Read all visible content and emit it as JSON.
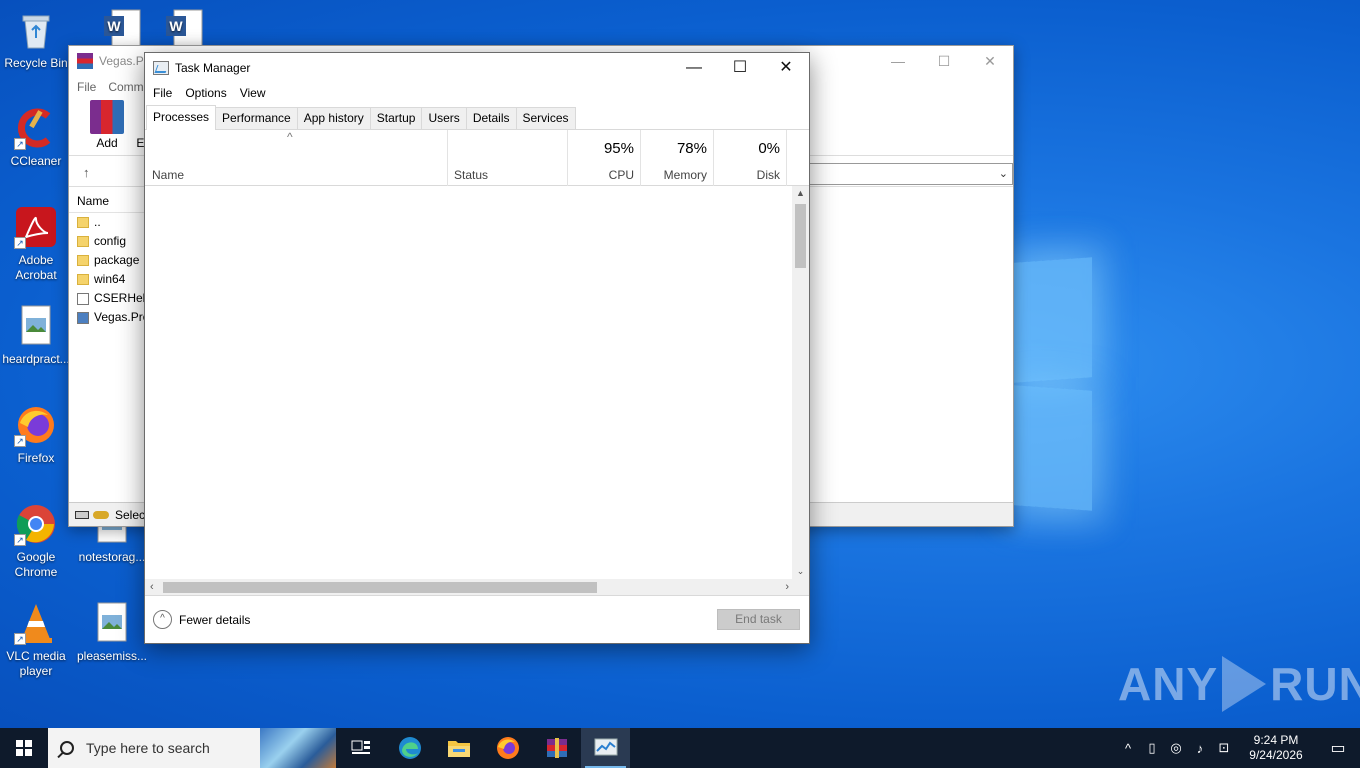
{
  "desktop": {
    "icons": [
      {
        "label": "Recycle Bin"
      },
      {
        "label": "CCleaner"
      },
      {
        "label": "Adobe Acrobat"
      },
      {
        "label": "heardpract..."
      },
      {
        "label": "Firefox"
      },
      {
        "label": "Google Chrome"
      },
      {
        "label": "VLC media player"
      },
      {
        "label": "notestorag..."
      },
      {
        "label": "pleasemiss..."
      }
    ],
    "watermark": {
      "left": "ANY",
      "right": "RUN"
    }
  },
  "winrar": {
    "title": "Vegas.Pro",
    "menu": [
      "File",
      "Comm"
    ],
    "toolbar": {
      "add": "Add",
      "next": "E"
    },
    "list_header": "Name",
    "rows": [
      "..",
      "config",
      "package",
      "win64",
      "CSERHelp",
      "Vegas.Pro"
    ],
    "status": "Select"
  },
  "taskmgr": {
    "title": "Task Manager",
    "menu": [
      "File",
      "Options",
      "View"
    ],
    "tabs": [
      "Processes",
      "Performance",
      "App history",
      "Startup",
      "Users",
      "Details",
      "Services"
    ],
    "active_tab": "Processes",
    "columns": {
      "name": "Name",
      "status": "Status",
      "cpu": {
        "pct": "95%",
        "label": "CPU"
      },
      "memory": {
        "pct": "78%",
        "label": "Memory"
      },
      "disk": {
        "pct": "0%",
        "label": "Disk"
      }
    },
    "footer": {
      "fewer_details": "Fewer details",
      "end_task": "End task"
    }
  },
  "taskbar": {
    "search_placeholder": "Type here to search",
    "time": "9:24 PM",
    "date": "9/24/2026"
  }
}
